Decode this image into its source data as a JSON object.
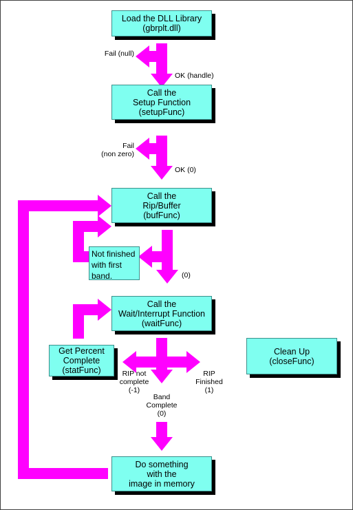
{
  "diagram": {
    "title": "DLL RIP workflow flowchart",
    "colors": {
      "box_fill": "#7FFFF0",
      "box_border": "#3a8f8a",
      "arrow": "#FF00FF",
      "shadow": "#000000",
      "frame": "#404040",
      "background": "#FFFFFF"
    }
  },
  "nodes": {
    "load_dll": {
      "line1": "Load the DLL Library",
      "line2": "(gbrplt.dll)"
    },
    "setup": {
      "line1": "Call the",
      "line2": "Setup Function",
      "line3": "(setupFunc)"
    },
    "rip_buffer": {
      "line1": "Call the",
      "line2": "Rip/Buffer",
      "line3": "(bufFunc)"
    },
    "not_finished": {
      "line1": "Not finished",
      "line2": "with first",
      "line3": "band."
    },
    "wait": {
      "line1": "Call the",
      "line2": "Wait/Interrupt Function",
      "line3": "(waitFunc)"
    },
    "get_percent": {
      "line1": "Get Percent",
      "line2": "Complete",
      "line3": "(statFunc)"
    },
    "clean_up": {
      "line1": "Clean Up",
      "line2": "(closeFunc)"
    },
    "do_something": {
      "line1": "Do something",
      "line2": "with the",
      "line3": "image in memory"
    }
  },
  "edge_labels": {
    "fail_null": "Fail (null)",
    "ok_handle": "OK (handle)",
    "fail_nonzero_1": "Fail",
    "fail_nonzero_2": "(non zero)",
    "ok_zero": "OK (0)",
    "buf_zero": "(0)",
    "rip_not_complete_1": "RIP not",
    "rip_not_complete_2": "complete",
    "rip_not_complete_3": "(-1)",
    "rip_finished_1": "RIP",
    "rip_finished_2": "Finished",
    "rip_finished_3": "(1)",
    "band_complete_1": "Band",
    "band_complete_2": "Complete",
    "band_complete_3": "(0)"
  }
}
